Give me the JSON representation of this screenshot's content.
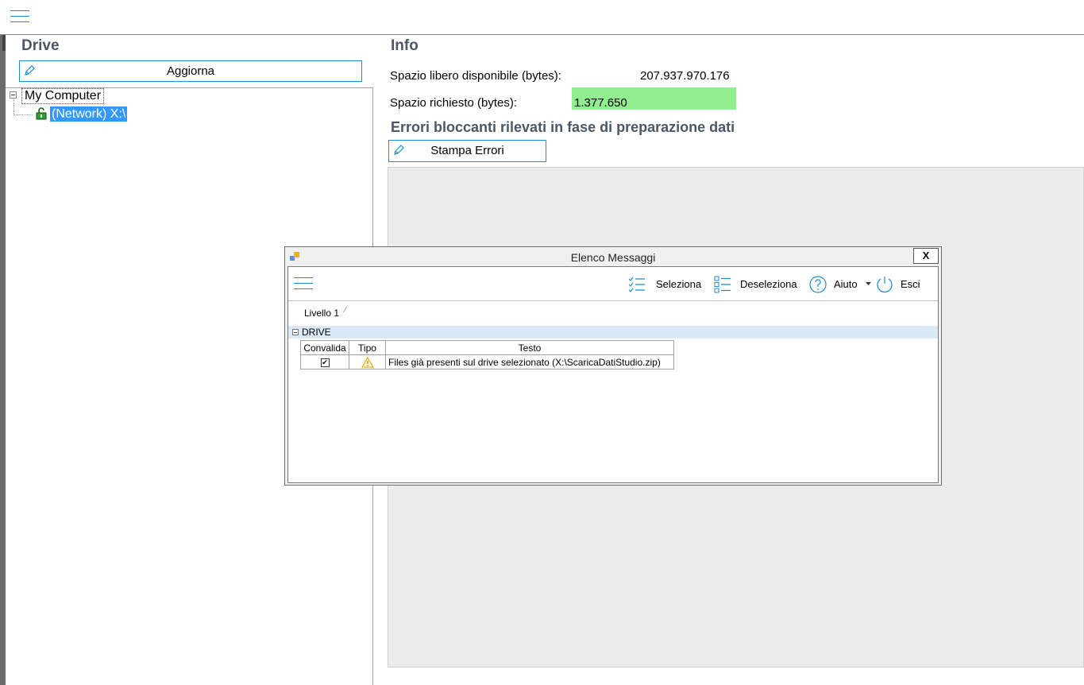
{
  "main": {
    "drive_heading": "Drive",
    "refresh_button": "Aggiorna",
    "tree": {
      "root": "My Computer",
      "child": "(Network) X:\\"
    },
    "info_heading": "Info",
    "free_space_label": "Spazio libero disponibile (bytes):",
    "free_space_value": "207.937.970.176",
    "required_space_label": "Spazio richiesto (bytes):",
    "required_space_value": "1.377.650",
    "errors_heading": "Errori bloccanti rilevati in fase di preparazione dati",
    "print_errors_button": "Stampa Errori"
  },
  "dialog": {
    "title": "Elenco Messaggi",
    "close_label": "X",
    "toolbar": {
      "select": "Seleziona",
      "deselect": "Deseleziona",
      "help": "Aiuto",
      "exit": "Esci"
    },
    "level_label": "Livello 1",
    "group_label": "DRIVE",
    "table": {
      "headers": [
        "Convalida",
        "Tipo",
        "Testo"
      ],
      "rows": [
        {
          "checked": true,
          "type_icon": "warning-icon",
          "text": "Files già presenti sul drive selezionato (X:\\ScaricaDatiStudio.zip)"
        }
      ]
    }
  },
  "colors": {
    "accent": "#1c8bd1",
    "highlight_green": "#90ee90",
    "selection": "#3399ff",
    "group_band": "#dbe9f7"
  }
}
